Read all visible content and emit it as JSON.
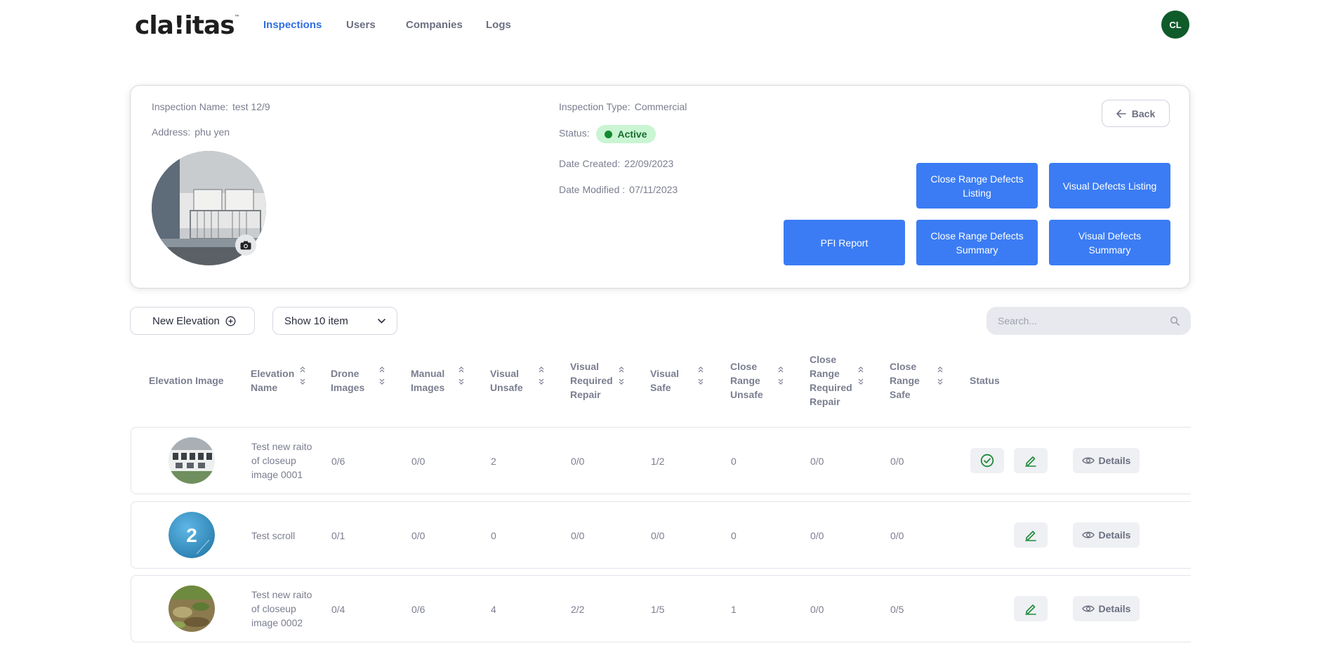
{
  "brand": {
    "name": "cla!itas",
    "tm": "™"
  },
  "nav": {
    "items": [
      "Inspections",
      "Users",
      "Companies",
      "Logs"
    ],
    "active": "Inspections"
  },
  "user": {
    "initials": "CL"
  },
  "inspection": {
    "name_label": "Inspection Name:",
    "name": "test 12/9",
    "address_label": "Address:",
    "address": "phu yen",
    "type_label": "Inspection Type:",
    "type": "Commercial",
    "status_label": "Status:",
    "status": "Active",
    "created_label": "Date Created:",
    "created": "22/09/2023",
    "modified_label": "Date Modified :",
    "modified": "07/11/2023"
  },
  "actions": {
    "back": "Back",
    "close_range_listing": "Close Range Defects Listing",
    "visual_listing": "Visual Defects Listing",
    "pfi_report": "PFI Report",
    "close_range_summary": "Close Range Defects Summary",
    "visual_summary": "Visual Defects Summary"
  },
  "toolbar": {
    "new_elevation": "New Elevation",
    "show_items": "Show 10 item",
    "search_placeholder": "Search..."
  },
  "table": {
    "headers": [
      "Elevation Image",
      "Elevation Name",
      "Drone Images",
      "Manual Images",
      "Visual Unsafe",
      "Visual Required Repair",
      "Visual Safe",
      "Close Range Unsafe",
      "Close Range Required Repair",
      "Close Range Safe",
      "Status"
    ],
    "details_label": "Details",
    "rows": [
      {
        "name": "Test new raito of closeup image 0001",
        "drone": "0/6",
        "manual": "0/0",
        "v_unsafe": "2",
        "v_repair": "0/0",
        "v_safe": "1/2",
        "c_unsafe": "0",
        "c_repair": "0/0",
        "c_safe": "0/0",
        "approved": true,
        "thumb": "building"
      },
      {
        "name": "Test scroll",
        "drone": "0/1",
        "manual": "0/0",
        "v_unsafe": "0",
        "v_repair": "0/0",
        "v_safe": "0/0",
        "c_unsafe": "0",
        "c_repair": "0/0",
        "c_safe": "0/0",
        "approved": false,
        "thumb": "number",
        "thumb_text": "2"
      },
      {
        "name": "Test new raito of closeup image 0002",
        "drone": "0/4",
        "manual": "0/6",
        "v_unsafe": "4",
        "v_repair": "2/2",
        "v_safe": "1/5",
        "c_unsafe": "1",
        "c_repair": "0/0",
        "c_safe": "0/5",
        "approved": false,
        "thumb": "ground"
      }
    ]
  },
  "colors": {
    "accent": "#3b7cf4",
    "nav_active": "#2f6fe0",
    "avatar": "#0f5b2a",
    "status_bg": "#c9f5d2",
    "edit_icon": "#1f8a3a"
  }
}
